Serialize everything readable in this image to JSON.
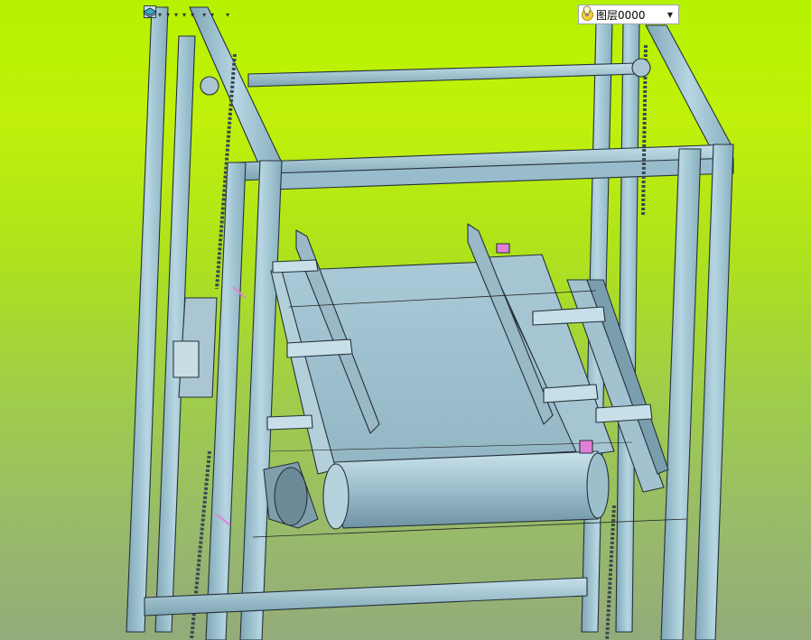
{
  "toolbar": {
    "items": [
      {
        "icon": "pick-icon",
        "has_dropdown": false
      },
      {
        "icon": "layers-icon",
        "has_dropdown": false
      },
      {
        "icon": "pen-icon",
        "has_dropdown": false
      },
      {
        "icon": "cube-wire-icon",
        "has_dropdown": false
      },
      {
        "icon": "cube-solid-icon",
        "has_dropdown": true
      },
      {
        "icon": "view-shade-icon",
        "has_dropdown": true
      },
      {
        "icon": "render-icon",
        "has_dropdown": true
      },
      {
        "icon": "section-icon",
        "has_dropdown": true
      },
      {
        "icon": "crosshair-icon",
        "has_dropdown": true
      },
      {
        "icon": "frame-icon",
        "has_dropdown": false
      },
      {
        "icon": "dimension-icon",
        "has_dropdown": true
      },
      {
        "icon": "grid-view-icon",
        "has_dropdown": true
      },
      {
        "icon": "line-weight-icon",
        "has_dropdown": false
      },
      {
        "icon": "color-swatch-icon",
        "has_dropdown": false
      },
      {
        "icon": "layer-stack-icon",
        "has_dropdown": true
      }
    ],
    "colors": {
      "swatch": "#cfe4f5",
      "line": "#000000"
    }
  },
  "layer": {
    "name": "图层0000",
    "bulb_icon": "lightbulb-icon",
    "status_icon": "sun-icon"
  },
  "scene": {
    "background_top": "#b6f200",
    "background_bottom": "#94ab7a",
    "frame_color": "#9fc4d2",
    "highlight_color": "#e27fd8"
  }
}
